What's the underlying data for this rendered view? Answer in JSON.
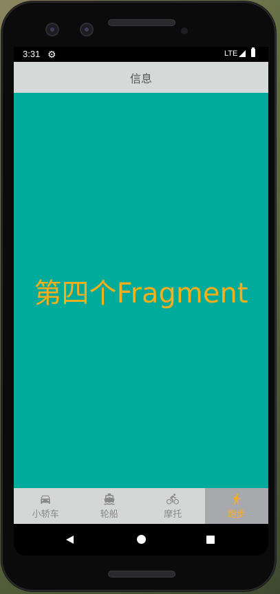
{
  "status_bar": {
    "time": "3:31",
    "settings_icon": "gear-icon",
    "network": "LTE",
    "signal_icon": "signal-icon",
    "battery_icon": "battery-icon"
  },
  "app_bar": {
    "title": "信息"
  },
  "content": {
    "text": "第四个Fragment",
    "background": "#00ab9b",
    "text_color": "#f5ae1c"
  },
  "bottom_nav": {
    "items": [
      {
        "label": "小轿车",
        "icon": "car-icon",
        "selected": false
      },
      {
        "label": "轮船",
        "icon": "ship-icon",
        "selected": false
      },
      {
        "label": "摩托",
        "icon": "bicycle-icon",
        "selected": false
      },
      {
        "label": "跑步",
        "icon": "running-icon",
        "selected": true
      }
    ],
    "active_color": "#f7ad23",
    "inactive_color": "#888888"
  },
  "system_nav": {
    "back": "back-icon",
    "home": "home-icon",
    "recents": "recents-icon"
  }
}
